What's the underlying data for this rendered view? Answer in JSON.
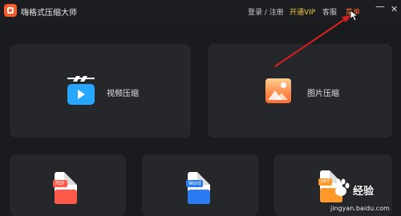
{
  "titlebar": {
    "app_title": "嗨格式压缩大师",
    "login": "登录 / 注册",
    "vip": "开通VIP",
    "service": "客服",
    "menu": "菜单",
    "minimize_glyph": "—",
    "close_glyph": "✕"
  },
  "cards": {
    "video": {
      "label": "视频压缩",
      "icon": "video-icon"
    },
    "image": {
      "label": "图片压缩",
      "icon": "image-icon"
    },
    "pdf": {
      "tag": "PDF",
      "icon": "pdf-icon"
    },
    "word": {
      "tag": "Word",
      "icon": "word-icon"
    },
    "ppt": {
      "tag": "PPT",
      "icon": "ppt-icon"
    }
  },
  "watermark": {
    "text": "经验",
    "url": "jingyan.baidu.com"
  },
  "colors": {
    "background": "#1a1b1e",
    "card": "#26272b",
    "accent_orange": "#ff6a2a",
    "vip_gold": "#f2c744",
    "arrow_red": "#d81e1e"
  }
}
